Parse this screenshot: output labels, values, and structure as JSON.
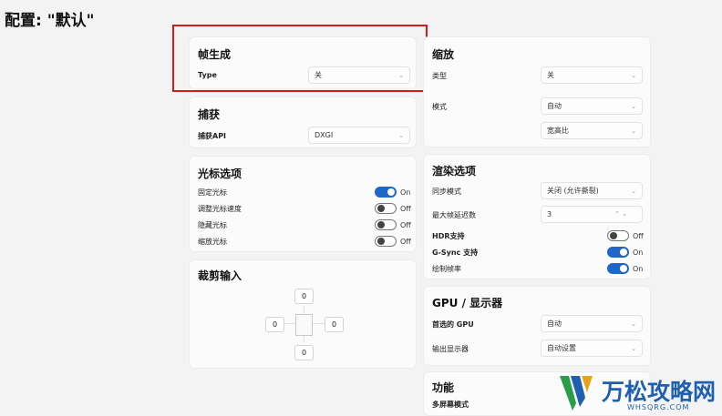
{
  "page": {
    "title": "配置: \"默认\""
  },
  "frame_gen": {
    "title": "帧生成",
    "type_label": "Type",
    "type_value": "关"
  },
  "capture": {
    "title": "捕获",
    "api_label": "捕获API",
    "api_value": "DXGI"
  },
  "cursor": {
    "title": "光标选项",
    "items": [
      {
        "label": "固定光标",
        "state": "On"
      },
      {
        "label": "调整光标速度",
        "state": "Off"
      },
      {
        "label": "隐藏光标",
        "state": "Off"
      },
      {
        "label": "缩放光标",
        "state": "Off"
      }
    ]
  },
  "crop": {
    "title": "裁剪输入",
    "top": "0",
    "left": "0",
    "right": "0",
    "bottom": "0"
  },
  "scaling": {
    "title": "缩放",
    "type_label": "类型",
    "type_value": "关",
    "mode_label": "模式",
    "mode_value": "自动",
    "aspect_value": "宽高比"
  },
  "render": {
    "title": "渲染选项",
    "sync_label": "同步模式",
    "sync_value": "关闭 (允许撕裂)",
    "max_frames_label": "最大帧延迟数",
    "max_frames_value": "3",
    "hdr_label": "HDR支持",
    "hdr_state": "Off",
    "gsync_label": "G-Sync 支持",
    "gsync_state": "On",
    "draw_fps_label": "绘制帧率",
    "draw_fps_state": "On"
  },
  "gpu": {
    "title": "GPU / 显示器",
    "gpu_label": "首选的 GPU",
    "gpu_value": "自动",
    "display_label": "输出显示器",
    "display_value": "自动设置"
  },
  "features": {
    "title": "功能",
    "multi_label": "多屏幕模式"
  },
  "watermark": {
    "text": "万松攻略网",
    "sub": "WHSQRG.COM"
  },
  "colors": {
    "accent": "#1e67c7",
    "highlight": "#d51a1a",
    "brand": "#1f5fb0"
  }
}
